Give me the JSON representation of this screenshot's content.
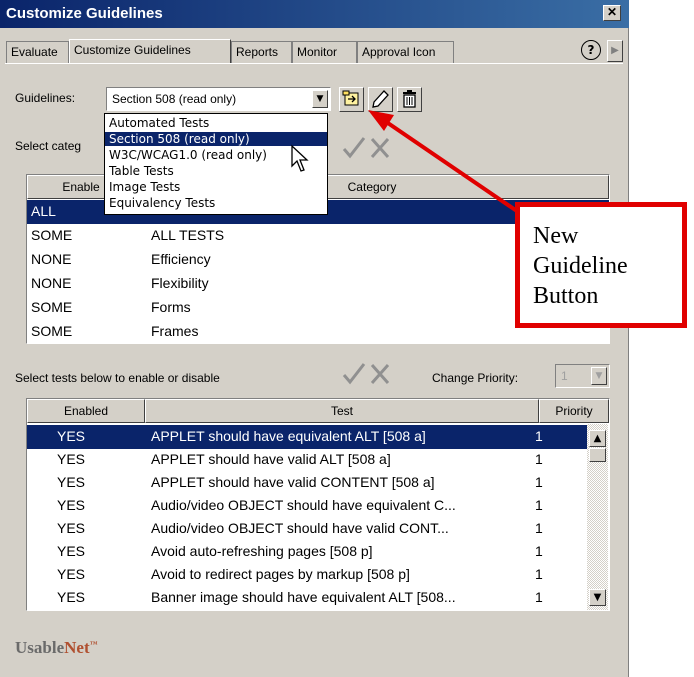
{
  "window": {
    "title": "Customize Guidelines",
    "close_glyph": "✕"
  },
  "tabs": [
    {
      "label": "Evaluate"
    },
    {
      "label": "Customize Guidelines"
    },
    {
      "label": "Reports"
    },
    {
      "label": "Monitor"
    },
    {
      "label": "Approval Icon"
    }
  ],
  "help_glyph": "?",
  "guidelines": {
    "label": "Guidelines:",
    "selected": "Section 508 (read only)",
    "options": [
      "Automated Tests",
      "Section 508 (read only)",
      "W3C/WCAG1.0 (read only)",
      "Table Tests",
      "Image Tests",
      "Equivalency Tests"
    ],
    "highlighted_index": 1
  },
  "toolbar_icons": [
    "new-guideline-icon",
    "edit-pencil-icon",
    "delete-trash-icon"
  ],
  "categories": {
    "label_fragment": "Select categ",
    "header_fragment": "Enable",
    "header_category": "Category",
    "rows": [
      {
        "enabled": "ALL",
        "category": ""
      },
      {
        "enabled": "SOME",
        "category": "ALL TESTS"
      },
      {
        "enabled": "NONE",
        "category": "Efficiency"
      },
      {
        "enabled": "NONE",
        "category": "Flexibility"
      },
      {
        "enabled": "SOME",
        "category": "Forms"
      },
      {
        "enabled": "SOME",
        "category": "Frames"
      }
    ]
  },
  "tests": {
    "label": "Select tests below to enable or disable",
    "priority_label": "Change Priority:",
    "priority_value": "1",
    "headers": {
      "enabled": "Enabled",
      "test": "Test",
      "priority": "Priority"
    },
    "rows": [
      {
        "enabled": "YES",
        "test": "APPLET should have equivalent ALT [508 a]",
        "priority": "1"
      },
      {
        "enabled": "YES",
        "test": "APPLET should have valid ALT [508 a]",
        "priority": "1"
      },
      {
        "enabled": "YES",
        "test": "APPLET should have valid CONTENT [508 a]",
        "priority": "1"
      },
      {
        "enabled": "YES",
        "test": "Audio/video OBJECT should have equivalent C...",
        "priority": "1"
      },
      {
        "enabled": "YES",
        "test": "Audio/video OBJECT should have valid CONT...",
        "priority": "1"
      },
      {
        "enabled": "YES",
        "test": "Avoid auto-refreshing pages [508 p]",
        "priority": "1"
      },
      {
        "enabled": "YES",
        "test": "Avoid to redirect pages by markup [508 p]",
        "priority": "1"
      },
      {
        "enabled": "YES",
        "test": "Banner image should have equivalent ALT [508...",
        "priority": "1"
      }
    ]
  },
  "brand": {
    "usable": "Usable",
    "net": "Net",
    "tm": "™"
  },
  "callout": {
    "lines": [
      "New",
      "Guideline",
      "Button"
    ]
  },
  "colors": {
    "selection": "#0a246a",
    "callout_red": "#e00000",
    "check_gray": "#909090"
  }
}
